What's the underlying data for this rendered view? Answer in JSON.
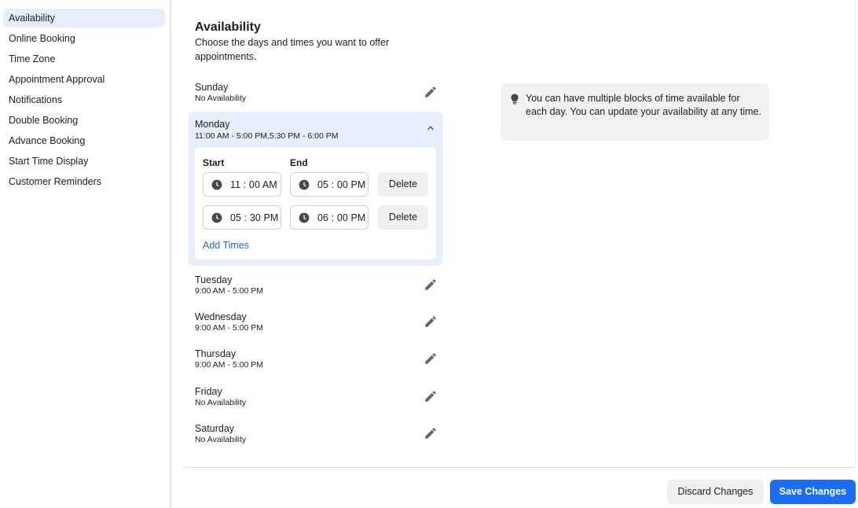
{
  "sidebar": {
    "items": [
      {
        "label": "Availability",
        "active": true
      },
      {
        "label": "Online Booking"
      },
      {
        "label": "Time Zone"
      },
      {
        "label": "Appointment Approval"
      },
      {
        "label": "Notifications"
      },
      {
        "label": "Double Booking"
      },
      {
        "label": "Advance Booking"
      },
      {
        "label": "Start Time Display"
      },
      {
        "label": "Customer Reminders"
      }
    ]
  },
  "main": {
    "title": "Availability",
    "description": "Choose the days and times you want to offer appointments.",
    "days": [
      {
        "name": "Sunday",
        "hours": "No Availability",
        "icon": "pencil-icon"
      },
      {
        "name": "Monday",
        "hours": "11:00 AM - 5:00 PM,5:30 PM - 6:00 PM",
        "icon": "chevron-up-icon",
        "expanded": true
      },
      {
        "name": "Tuesday",
        "hours": "9:00 AM - 5:00 PM",
        "icon": "pencil-icon"
      },
      {
        "name": "Wednesday",
        "hours": "9:00 AM - 5:00 PM",
        "icon": "pencil-icon"
      },
      {
        "name": "Thursday",
        "hours": "9:00 AM - 5:00 PM",
        "icon": "pencil-icon"
      },
      {
        "name": "Friday",
        "hours": "No Availability",
        "icon": "pencil-icon"
      },
      {
        "name": "Saturday",
        "hours": "No Availability",
        "icon": "pencil-icon"
      }
    ],
    "editor": {
      "start_label": "Start",
      "end_label": "End",
      "blocks": [
        {
          "start": "11 : 00 AM",
          "end": "05 : 00 PM",
          "delete_label": "Delete"
        },
        {
          "start": "05 : 30 PM",
          "end": "06 : 00 PM",
          "delete_label": "Delete"
        }
      ],
      "add_times_label": "Add Times"
    },
    "tip": {
      "icon": "lightbulb-icon",
      "text": "You can have multiple blocks of time available for each day. You can update your availability at any time."
    }
  },
  "footer": {
    "discard_label": "Discard Changes",
    "save_label": "Save Changes"
  },
  "colors": {
    "accent": "#1b6ef3",
    "link": "#1a6ed8",
    "active_bg": "#e7eefc",
    "tip_bg": "#f2f2f2"
  }
}
